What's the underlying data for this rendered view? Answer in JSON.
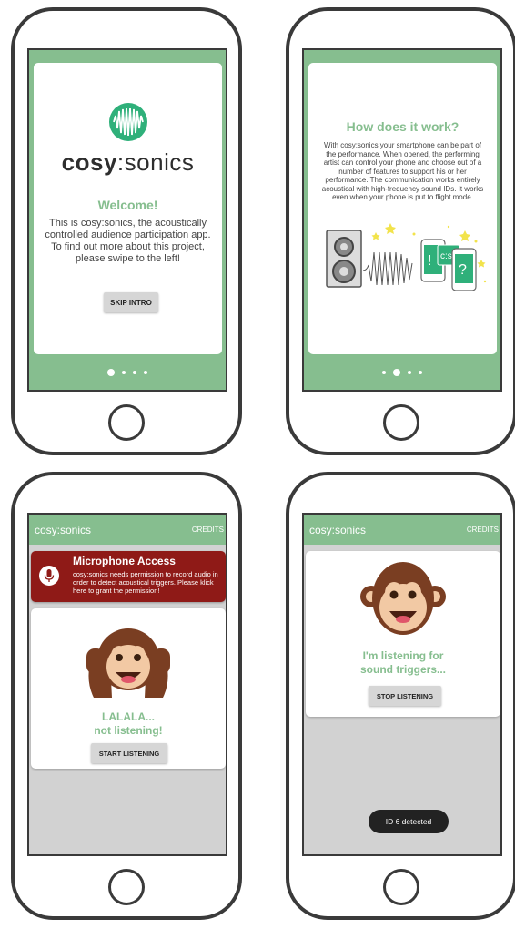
{
  "phone1": {
    "logo_text_bold": "cosy",
    "logo_text_light": ":sonics",
    "welcome_title": "Welcome!",
    "welcome_body": "This is cosy:sonics, the acoustically controlled audience participation app. To find out more about this project, please swipe to the left!",
    "skip_button": "SKIP INTRO",
    "pager": {
      "pages": 4,
      "active": 1
    }
  },
  "phone2": {
    "title": "How does it work?",
    "body": "With cosy:sonics your smartphone can be part of the performance. When opened, the performing artist can control your phone and choose out of a number of features to support his or her performance. The communication works entirely acoustical with high-frequency sound IDs. It works even when your phone is put to flight mode.",
    "illustration_labels": {
      "exclaim": "!",
      "logo": "c:s",
      "question": "?"
    },
    "pager": {
      "pages": 4,
      "active": 2
    }
  },
  "phone3": {
    "app_title": "cosy:sonics",
    "credits": "CREDITS",
    "mic_title": "Microphone Access",
    "mic_text": "cosy:sonics needs permission to record audio in order to detect acoustical triggers. Please klick here to grant the permission!",
    "status_line1": "LALALA...",
    "status_line2": "not listening!",
    "start_button": "START LISTENING"
  },
  "phone4": {
    "app_title": "cosy:sonics",
    "credits": "CREDITS",
    "status_line1": "I'm listening for",
    "status_line2": "sound triggers...",
    "stop_button": "STOP LISTENING",
    "toast": "ID 6 detected"
  },
  "colors": {
    "accent_green": "#86be8f",
    "logo_green": "#2fb07a",
    "alert_red": "#8f1a17",
    "monkey_brown": "#7a3e22",
    "monkey_face": "#f2c9a4"
  }
}
